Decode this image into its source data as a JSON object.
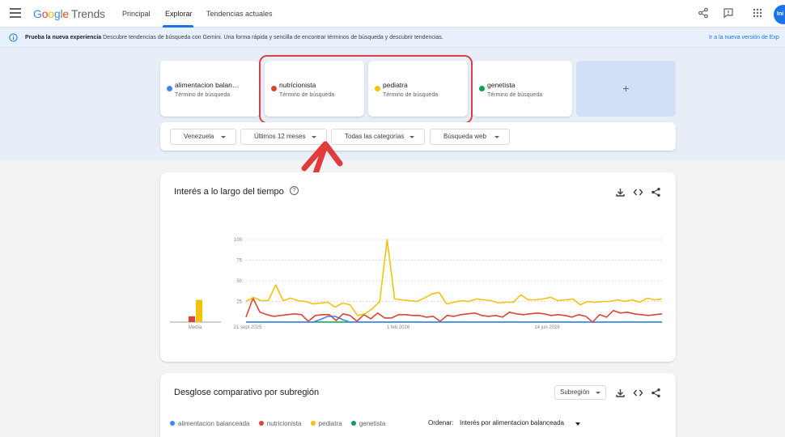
{
  "header": {
    "logo_google": [
      "G",
      "o",
      "o",
      "g",
      "l",
      "e"
    ],
    "logo_trends": "Trends",
    "nav": [
      "Principal",
      "Explorar",
      "Tendencias actuales"
    ],
    "avatar_text": "Ini"
  },
  "banner": {
    "bold": "Prueba la nueva experiencia",
    "text": " Descubre tendencias de búsqueda con Gemini. Una forma rápida y sencilla de encontrar términos de búsqueda y descubrir tendencias.",
    "link": "Ir a la nueva versión de Exp"
  },
  "terms": [
    {
      "name": "alimentacion balan…",
      "sub": "Término de búsqueda",
      "color": "#4285f4"
    },
    {
      "name": "nutricionista",
      "sub": "Término de búsqueda",
      "color": "#db4437"
    },
    {
      "name": "pediatra",
      "sub": "Término de búsqueda",
      "color": "#f4c20d"
    },
    {
      "name": "genetista",
      "sub": "Término de búsqueda",
      "color": "#0f9d58"
    }
  ],
  "add_term": "+",
  "filters": [
    "Venezuela",
    "Últimos 12 meses",
    "Todas las categorías",
    "Búsqueda web"
  ],
  "interest_card": {
    "title": "Interés a lo largo del tiempo",
    "help": "?"
  },
  "chart_data": {
    "type": "line",
    "title": "Interés a lo largo del tiempo",
    "ylim": [
      0,
      100
    ],
    "yticks": [
      "100",
      "75",
      "50",
      "25"
    ],
    "xticks": [
      "21 sept 2025",
      "1 feb 2026",
      "14 jun 2026"
    ],
    "average_label": "Media",
    "averages": [
      {
        "name": "nutricionista",
        "value": 7,
        "color": "#db4437"
      },
      {
        "name": "pediatra",
        "value": 27,
        "color": "#f4c20d"
      }
    ],
    "series": [
      {
        "name": "pediatra",
        "color": "#f4c20d",
        "values": [
          25,
          30,
          26,
          26,
          45,
          26,
          29,
          26,
          25,
          22,
          23,
          24,
          18,
          23,
          21,
          8,
          10,
          16,
          25,
          100,
          28,
          27,
          26,
          25,
          29,
          34,
          36,
          22,
          24,
          26,
          25,
          28,
          27,
          26,
          23,
          24,
          24,
          33,
          27,
          27,
          28,
          30,
          26,
          27,
          28,
          21,
          25,
          24,
          25,
          25,
          27,
          25,
          27,
          24,
          29,
          27,
          28
        ]
      },
      {
        "name": "nutricionista",
        "color": "#db4437",
        "values": [
          6,
          29,
          12,
          9,
          7,
          8,
          9,
          10,
          9,
          1,
          8,
          9,
          9,
          2,
          10,
          8,
          1,
          9,
          4,
          11,
          5,
          5,
          9,
          9,
          8,
          8,
          6,
          7,
          1,
          8,
          7,
          9,
          10,
          11,
          8,
          7,
          8,
          6,
          12,
          10,
          9,
          10,
          11,
          10,
          8,
          9,
          8,
          6,
          9,
          7,
          0,
          9,
          6,
          14,
          11,
          12,
          10,
          9,
          8,
          9,
          10
        ]
      },
      {
        "name": "alimentacion balanceada",
        "color": "#4285f4",
        "values": [
          0,
          0,
          0,
          0,
          0,
          0,
          0,
          0,
          0,
          0,
          3,
          7,
          7,
          3,
          0,
          0,
          0,
          0,
          0,
          0,
          0,
          0,
          0,
          0,
          0,
          0,
          0,
          0,
          0,
          0,
          0,
          0,
          0,
          0,
          0,
          0,
          0,
          0,
          0,
          0,
          0,
          0,
          0,
          0,
          0,
          0,
          0,
          0,
          0,
          0,
          0,
          0,
          0,
          0,
          0,
          0,
          0
        ]
      },
      {
        "name": "genetista",
        "color": "#0f9d58",
        "values": [
          0,
          0,
          0,
          0,
          0,
          0,
          0,
          0,
          0,
          0,
          0,
          0,
          0,
          0,
          0,
          0,
          0,
          0,
          0,
          0,
          0,
          0,
          0,
          0,
          0,
          0,
          0,
          0,
          0,
          0,
          0,
          0,
          0,
          0,
          0,
          0,
          0,
          0,
          0,
          0,
          0,
          0,
          0,
          0,
          0,
          0,
          0,
          0,
          0,
          0,
          0,
          0,
          0,
          0,
          0,
          0,
          0
        ]
      }
    ]
  },
  "breakdown_card": {
    "title": "Desglose comparativo por subregión",
    "select": "Subregión",
    "legend": [
      "alimentacion balanceada",
      "nutricionista",
      "pediatra",
      "genetista"
    ],
    "sort_label": "Ordenar:",
    "sort_value": "Interés por alimentacion balanceada"
  }
}
